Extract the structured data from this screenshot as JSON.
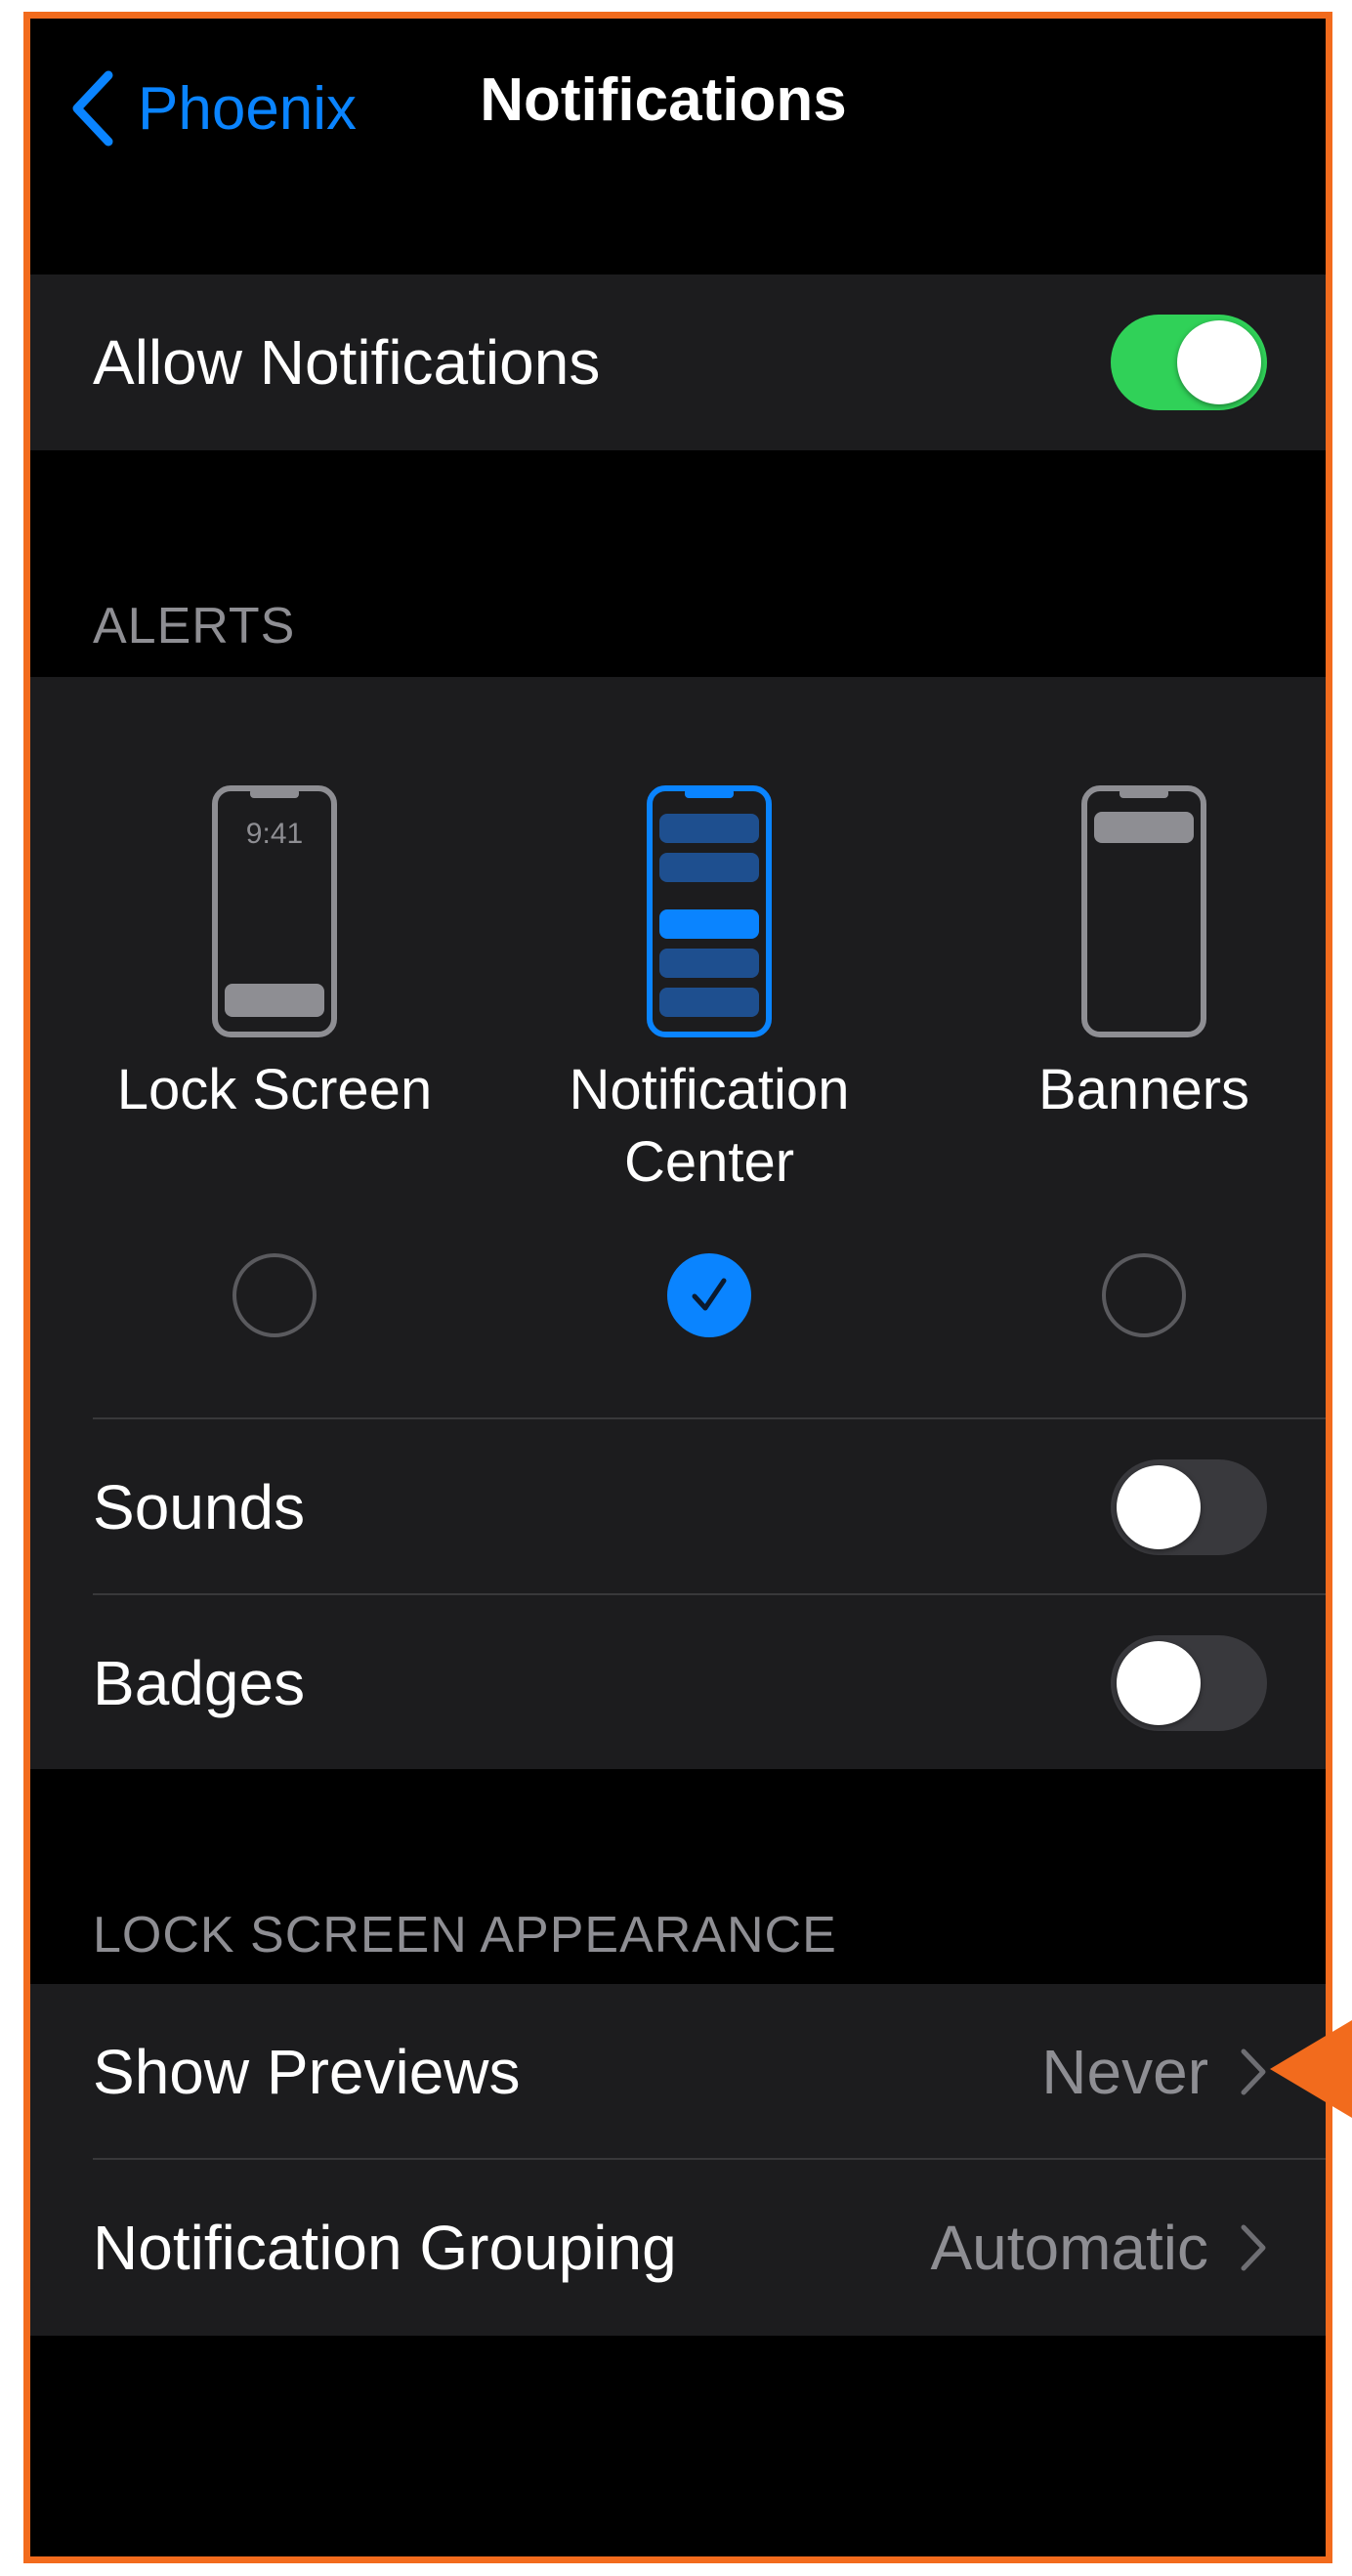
{
  "nav": {
    "back_label": "Phoenix",
    "title": "Notifications"
  },
  "allow": {
    "label": "Allow Notifications",
    "on": true
  },
  "alerts": {
    "header": "ALERTS",
    "styles": [
      {
        "label": "Lock Screen",
        "selected": false,
        "clock": "9:41"
      },
      {
        "label": "Notification\nCenter",
        "selected": true
      },
      {
        "label": "Banners",
        "selected": false
      }
    ],
    "sounds": {
      "label": "Sounds",
      "on": false
    },
    "badges": {
      "label": "Badges",
      "on": false
    }
  },
  "lock_screen": {
    "header": "LOCK SCREEN APPEARANCE",
    "show_previews": {
      "label": "Show Previews",
      "value": "Never"
    },
    "grouping": {
      "label": "Notification Grouping",
      "value": "Automatic"
    }
  },
  "colors": {
    "accent": "#0a84ff",
    "toggle_on": "#30d158",
    "annotation": "#f26b1d"
  }
}
